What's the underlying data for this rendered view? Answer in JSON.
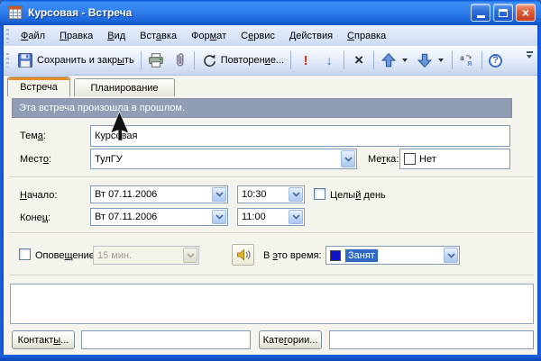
{
  "window": {
    "title": "Курсовая - Встреча"
  },
  "menu": {
    "items": [
      {
        "pre": "",
        "key": "Ф",
        "post": "айл"
      },
      {
        "pre": "",
        "key": "П",
        "post": "равка"
      },
      {
        "pre": "",
        "key": "В",
        "post": "ид"
      },
      {
        "pre": "Вст",
        "key": "а",
        "post": "вка"
      },
      {
        "pre": "Фор",
        "key": "м",
        "post": "ат"
      },
      {
        "pre": "С",
        "key": "е",
        "post": "рвис"
      },
      {
        "pre": "",
        "key": "Д",
        "post": "ействия"
      },
      {
        "pre": "",
        "key": "С",
        "post": "правка"
      }
    ]
  },
  "toolbar": {
    "save_label": {
      "pre": "Сохранить и закр",
      "key": "ы",
      "post": "ть"
    },
    "recurrence_label": {
      "pre": "Повторен",
      "key": "и",
      "post": "е..."
    },
    "importance_glyph": "!",
    "down_glyph": "↓",
    "delete_glyph": "×",
    "help_glyph": "?"
  },
  "tabs": {
    "appointment": "Встреча",
    "scheduling": "Планирование"
  },
  "banner": {
    "text": "Эта встреча произошла в прошлом."
  },
  "form": {
    "subject": {
      "label": {
        "pre": "Тем",
        "key": "а",
        "post": ":"
      },
      "value": "Курсовая"
    },
    "location": {
      "label": {
        "pre": "Мест",
        "key": "о",
        "post": ":"
      },
      "value": "ТулГУ"
    },
    "flag": {
      "label": {
        "pre": "Ме",
        "key": "т",
        "post": "ка:"
      },
      "value": "Нет",
      "swatch_color": "#FFFFFF"
    },
    "start": {
      "label": {
        "pre": "",
        "key": "Н",
        "post": "ачало:"
      },
      "date": "Вт 07.11.2006",
      "time": "10:30"
    },
    "end": {
      "label": {
        "pre": "Коне",
        "key": "ц",
        "post": ":"
      },
      "date": "Вт 07.11.2006",
      "time": "11:00"
    },
    "all_day": {
      "label": {
        "pre": "Целы",
        "key": "й",
        "post": " день"
      },
      "checked": false
    },
    "reminder": {
      "label": {
        "pre": "Опове",
        "key": "щ",
        "post": "ение:"
      },
      "value": "15 мин.",
      "checked": false,
      "enabled": false
    },
    "show_time_as": {
      "label": {
        "pre": "В ",
        "key": "э",
        "post": "то время:"
      },
      "value": "Занят",
      "swatch_color": "#1213C6"
    },
    "notes": "",
    "contacts": {
      "button": {
        "pre": "Контакт",
        "key": "ы",
        "post": "..."
      },
      "value": ""
    },
    "categories": {
      "button": {
        "pre": "Кате",
        "key": "г",
        "post": "ории..."
      },
      "value": ""
    }
  },
  "colors": {
    "titlebar": "#2F80EC",
    "banner_bg": "#8F9DB5",
    "selection": "#316AC5",
    "tab_accent": "#E68B2C",
    "busy_swatch": "#1213C6"
  }
}
